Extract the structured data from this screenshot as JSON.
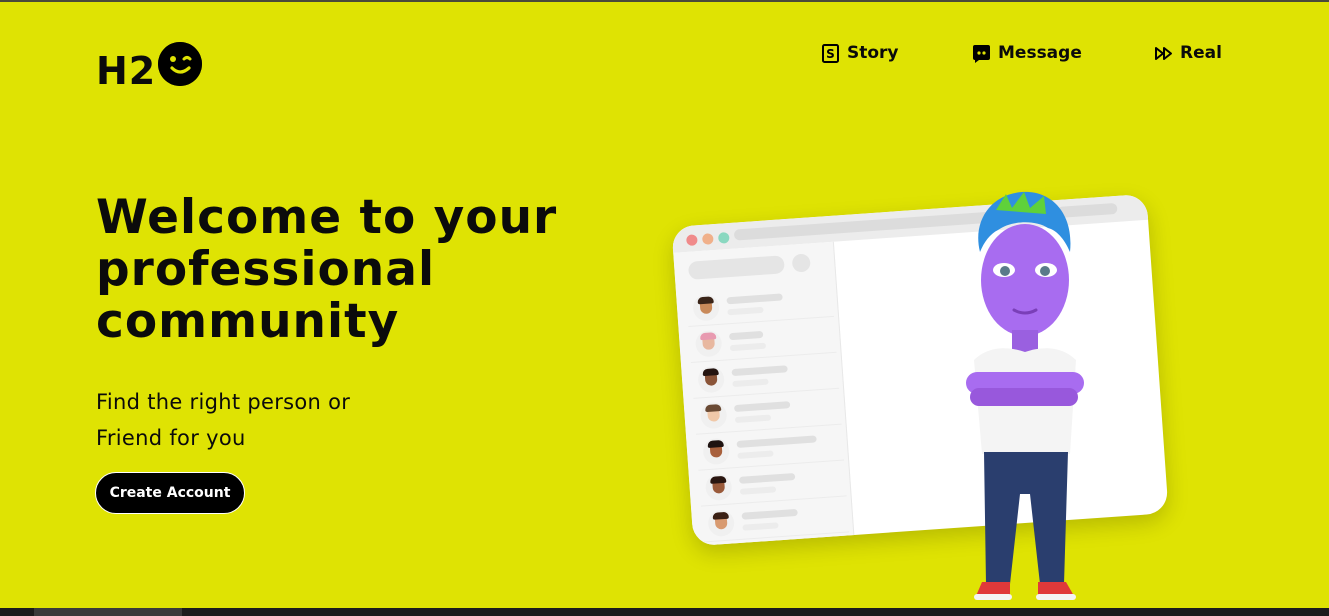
{
  "brand": {
    "logo_text": "H2",
    "logo_icon": "winking-face-icon"
  },
  "nav": {
    "items": [
      {
        "label": "Story",
        "icon": "story-icon"
      },
      {
        "label": "Message",
        "icon": "message-icon"
      },
      {
        "label": "Real",
        "icon": "fast-forward-icon"
      }
    ]
  },
  "hero": {
    "title": "Welcome to your professional community",
    "subtitle_line1": "Find the right person or",
    "subtitle_line2": "Friend for you",
    "cta_label": "Create Account"
  },
  "colors": {
    "background": "#dfe303",
    "text": "#0b0b0b",
    "button_bg": "#000000",
    "button_text": "#ffffff"
  }
}
